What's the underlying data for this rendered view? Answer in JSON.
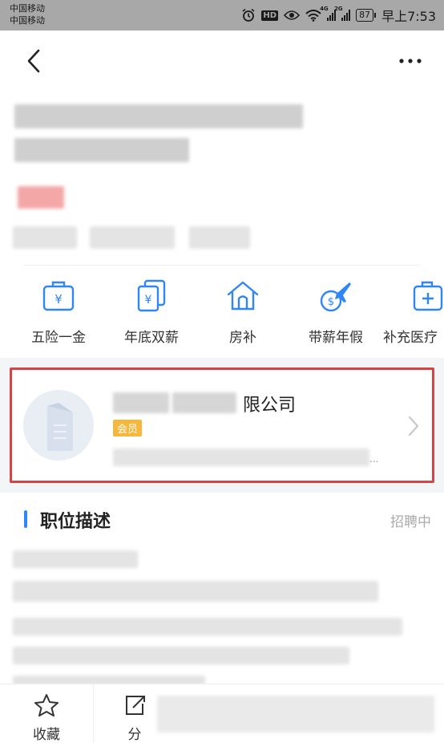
{
  "status_bar": {
    "carrier_1": "中国移动",
    "carrier_2": "中国移动",
    "hd": "HD",
    "net_1": "4G",
    "net_2": "2G",
    "battery": "87",
    "time": "早上7:53"
  },
  "benefits": [
    {
      "label": "五险一金",
      "icon": "briefcase-yen-icon"
    },
    {
      "label": "年底双薪",
      "icon": "double-card-yen-icon"
    },
    {
      "label": "房补",
      "icon": "house-icon"
    },
    {
      "label": "带薪年假",
      "icon": "airplane-coin-icon"
    },
    {
      "label": "补充医疗",
      "icon": "medical-kit-icon"
    }
  ],
  "company": {
    "name_visible": "限公司",
    "badge": "会员",
    "truncated_suffix": "...",
    "accent_border": "#d64545"
  },
  "job_description": {
    "title": "职位描述",
    "status": "招聘中",
    "accent": "#2f86f6"
  },
  "bottom_bar": {
    "favorite_label": "收藏",
    "share_label": "分"
  },
  "colors": {
    "icon_blue": "#2f86f6",
    "badge_orange": "#f6b73c"
  }
}
